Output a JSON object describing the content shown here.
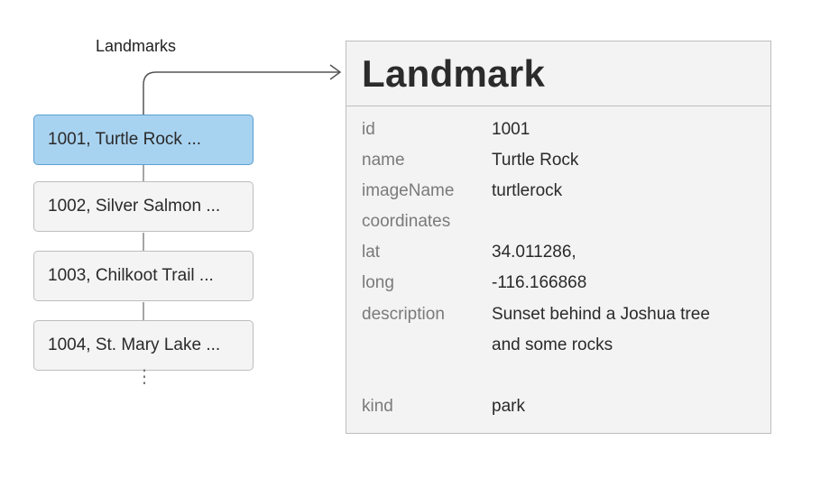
{
  "list": {
    "title": "Landmarks",
    "items": [
      {
        "label": "1001, Turtle Rock ..."
      },
      {
        "label": "1002, Silver Salmon ..."
      },
      {
        "label": "1003, Chilkoot Trail ..."
      },
      {
        "label": "1004, St. Mary Lake ..."
      }
    ],
    "more": "⋮"
  },
  "detail": {
    "title": "Landmark",
    "fields": [
      {
        "key": "id",
        "value": "1001"
      },
      {
        "key": "name",
        "value": "Turtle Rock"
      },
      {
        "key": "imageName",
        "value": "turtlerock"
      },
      {
        "key": "coordinates",
        "value": ""
      },
      {
        "key": "lat",
        "value": "34.011286,"
      },
      {
        "key": "long",
        "value": "-116.166868"
      },
      {
        "key": "description",
        "value": "Sunset behind a Joshua tree"
      },
      {
        "key": "",
        "value": "and some rocks"
      },
      {
        "key": "kind",
        "value": "park"
      }
    ]
  },
  "colors": {
    "selected_fill": "#a8d3f0",
    "selected_border": "#5a9fd0",
    "card_fill": "#f4f4f4",
    "panel_fill": "#f3f3f3",
    "border": "#bdbdbd",
    "connector": "#555555"
  }
}
